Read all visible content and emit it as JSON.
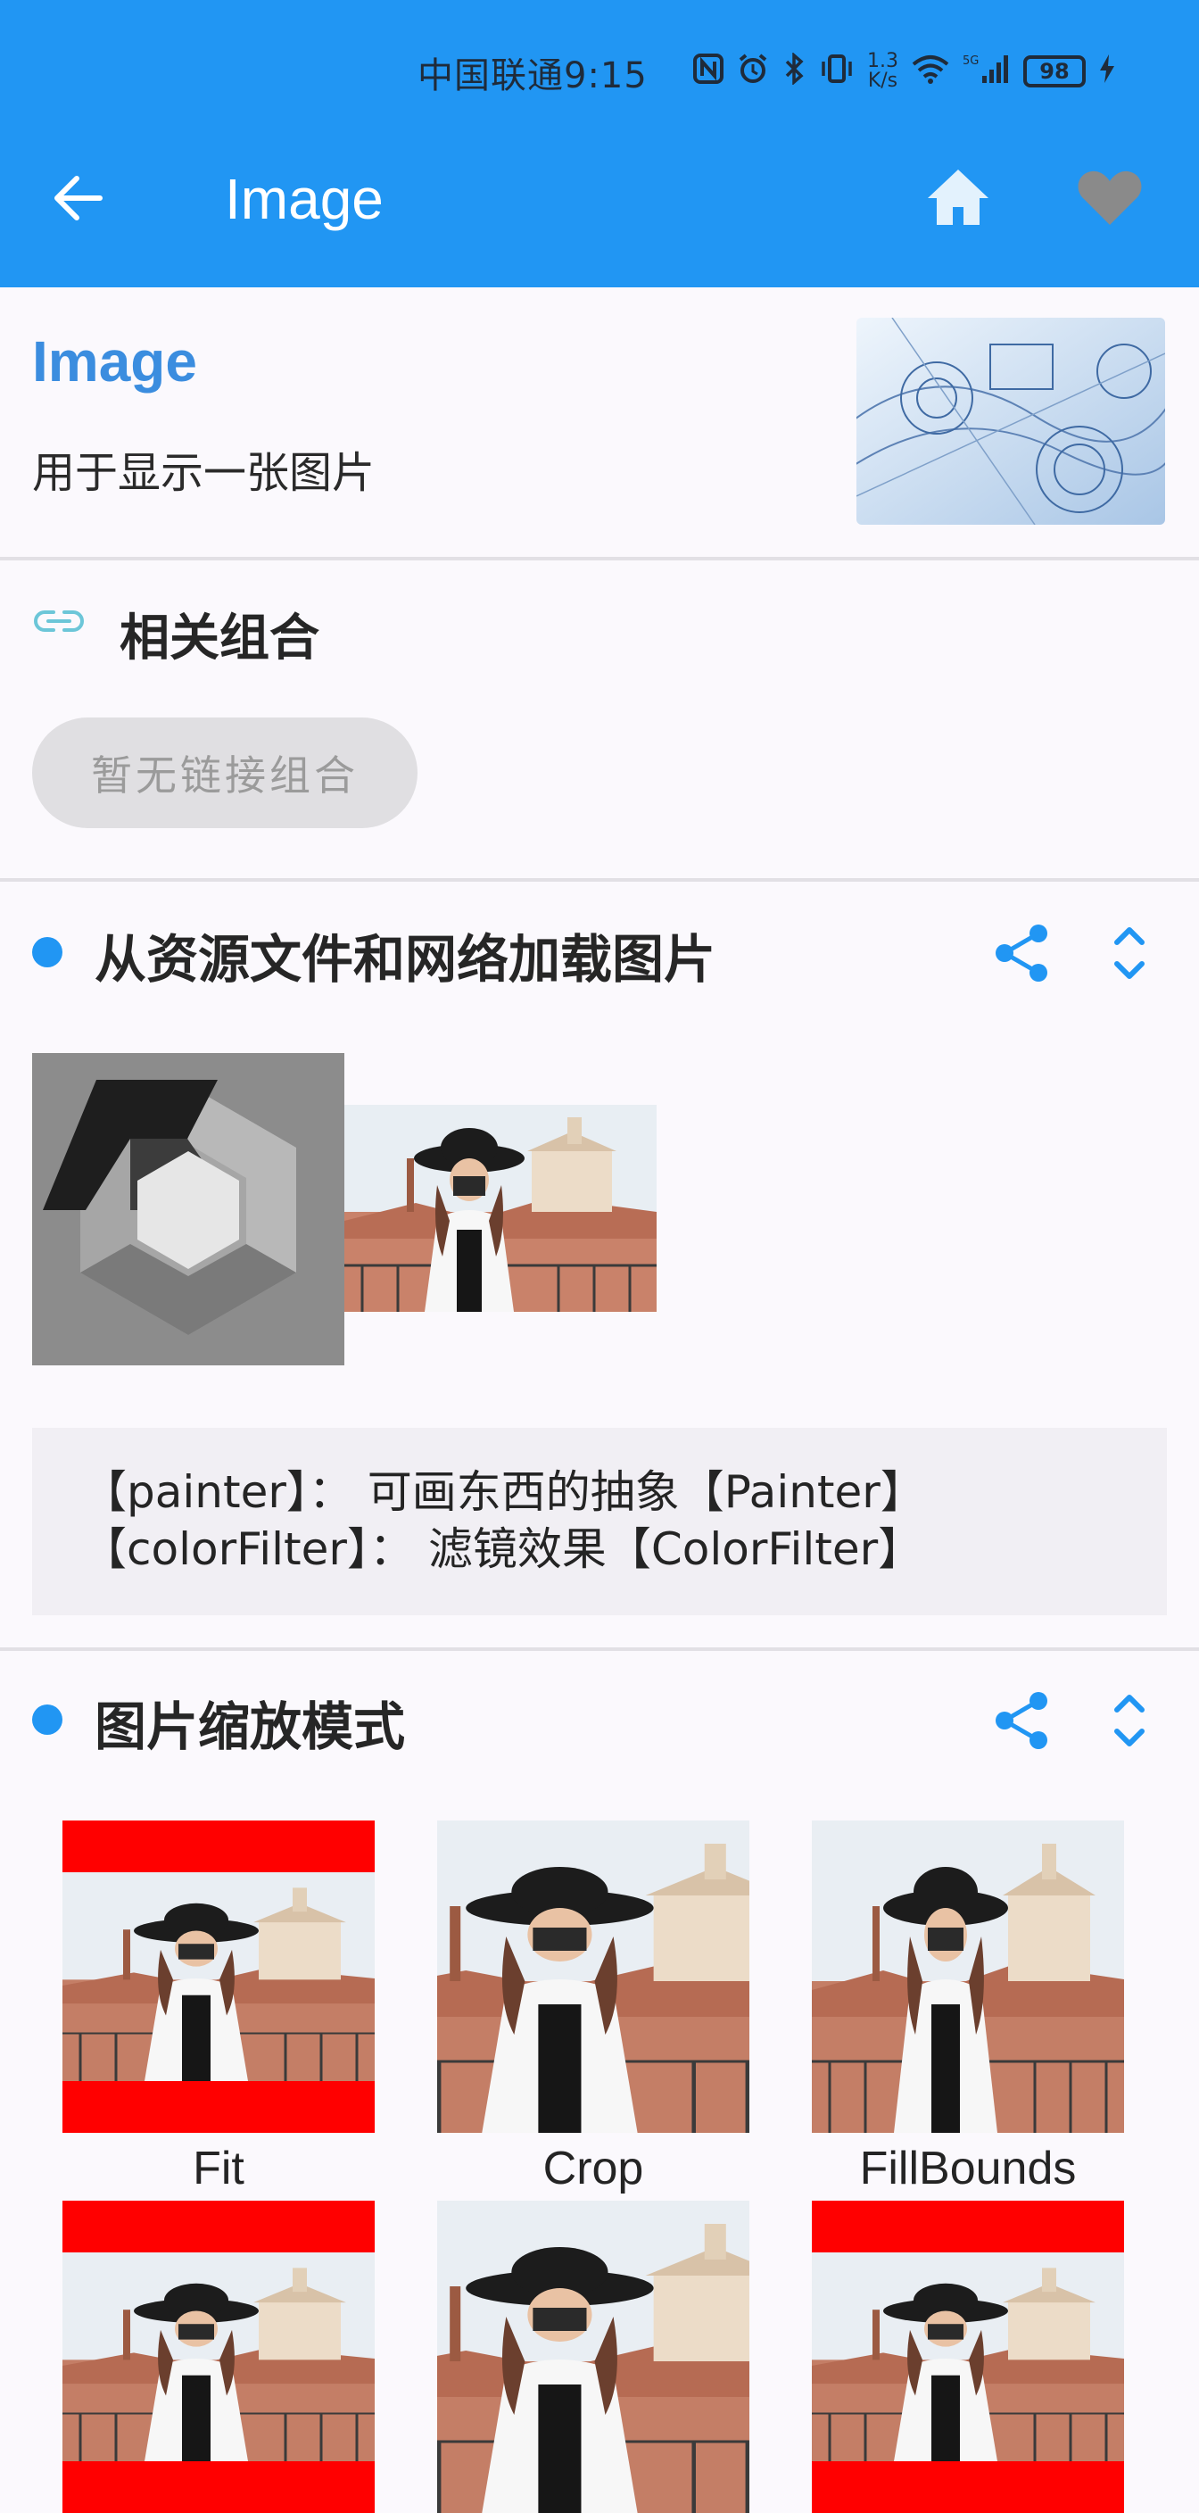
{
  "status_bar": {
    "carrier_time": "中国联通9:15",
    "speed_top": "1.3",
    "speed_bottom": "K/s",
    "network": "5G",
    "battery": "98"
  },
  "toolbar": {
    "title": "Image",
    "back_icon": "arrow-left-icon",
    "home_icon": "home-icon",
    "favorite_icon": "heart-icon",
    "color": "#2196f3"
  },
  "intro": {
    "title": "Image",
    "description": "用于显示一张图片"
  },
  "related": {
    "title": "相关组合",
    "chip_label": "暂无链接组合"
  },
  "sections": [
    {
      "title": "从资源文件和网络加载图片",
      "desc_lines": [
        "【painter】： 可画东西的抽象【Painter】",
        "【colorFilter】： 滤镜效果【ColorFilter】"
      ]
    },
    {
      "title": "图片缩放模式",
      "scale_modes": [
        "Fit",
        "Crop",
        "FillBounds",
        "",
        "",
        ""
      ]
    }
  ]
}
